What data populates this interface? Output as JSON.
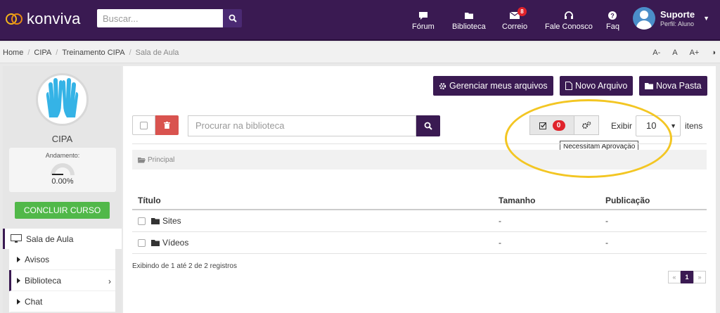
{
  "header": {
    "logo_text": "konviva",
    "search_placeholder": "Buscar...",
    "nav": [
      {
        "label": "Fórum",
        "icon": "chat-icon"
      },
      {
        "label": "Biblioteca",
        "icon": "folder-icon"
      },
      {
        "label": "Correio",
        "icon": "envelope-icon",
        "badge": "8"
      },
      {
        "label": "Fale Conosco",
        "icon": "headset-icon"
      },
      {
        "label": "Faq",
        "icon": "question-icon"
      }
    ],
    "user": {
      "name": "Suporte",
      "role": "Perfil: Aluno"
    }
  },
  "breadcrumb": [
    "Home",
    "CIPA",
    "Treinamento CIPA",
    "Sala de Aula"
  ],
  "accessibility": [
    "A-",
    "A",
    "A+"
  ],
  "sidebar": {
    "course_title": "CIPA",
    "progress_label": "Andamento:",
    "progress_value": "0.00%",
    "progress_fraction": 0,
    "conclude_label": "CONCLUIR CURSO",
    "menu_main": "Sala de Aula",
    "menu_items": [
      "Avisos",
      "Biblioteca",
      "Chat"
    ]
  },
  "main": {
    "btn_manage": "Gerenciar meus arquivos",
    "btn_new_file": "Novo Arquivo",
    "btn_new_folder": "Nova Pasta",
    "search_placeholder": "Procurar na biblioteca",
    "approval_count": "0",
    "tooltip": "Necessitam Aprovação",
    "show_label": "Exibir",
    "show_value": "10",
    "items_label": "itens",
    "folder_path": "Principal",
    "columns": [
      "Título",
      "Tamanho",
      "Publicação"
    ],
    "rows": [
      {
        "title": "Sites",
        "size": "-",
        "date": "-"
      },
      {
        "title": "Vídeos",
        "size": "-",
        "date": "-"
      }
    ],
    "footer_info": "Exibindo de 1 até 2 de 2 registros",
    "pagination": {
      "prev": "«",
      "current": "1",
      "next": "»"
    }
  },
  "colors": {
    "brand": "#3a1a52",
    "success": "#51b849",
    "danger": "#e0232b",
    "highlight": "#f3c623"
  }
}
